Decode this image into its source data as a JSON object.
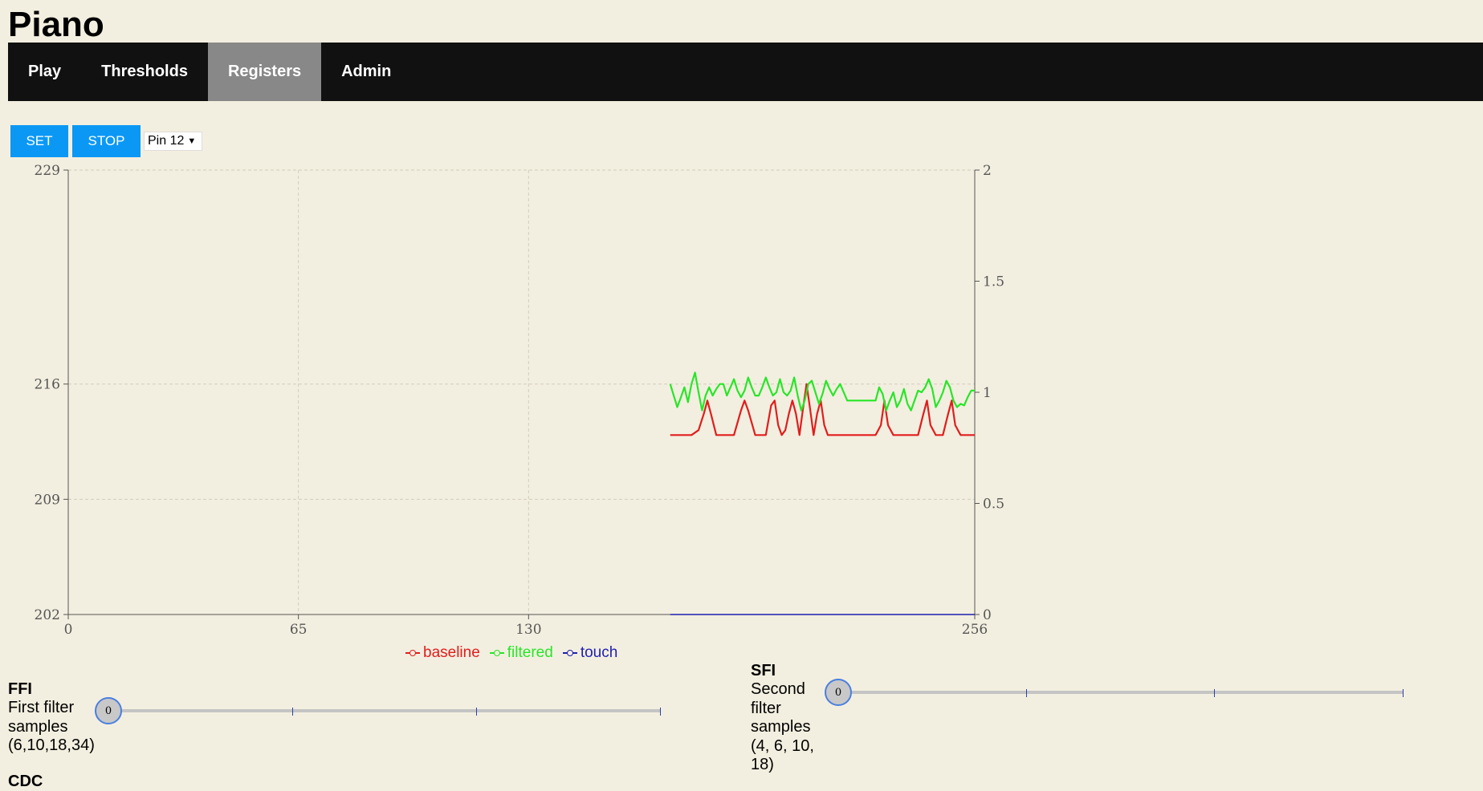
{
  "app": {
    "title": "Piano"
  },
  "nav": {
    "items": [
      {
        "label": "Play"
      },
      {
        "label": "Thresholds"
      },
      {
        "label": "Registers"
      },
      {
        "label": "Admin"
      }
    ]
  },
  "toolbar": {
    "set_label": "SET",
    "stop_label": "STOP",
    "pin_selected": "Pin 12"
  },
  "chart_data": {
    "type": "line",
    "x_ticks": [
      0,
      65,
      130,
      256
    ],
    "xlim": [
      0,
      256
    ],
    "y_left_ticks": [
      202,
      209,
      216,
      229
    ],
    "ylim_left": [
      202,
      229
    ],
    "y_right_ticks": [
      0,
      0.5,
      1,
      1.5,
      2
    ],
    "ylim_right": [
      0,
      2
    ],
    "grid": true,
    "legend_position": "bottom-center",
    "series": [
      {
        "name": "baseline",
        "axis": "left",
        "color": "#e11d1d",
        "points": [
          [
            170,
            212.9
          ],
          [
            176,
            212.9
          ],
          [
            178,
            213.2
          ],
          [
            179.5,
            214.2
          ],
          [
            180.5,
            215
          ],
          [
            181.5,
            214.2
          ],
          [
            183,
            212.9
          ],
          [
            188,
            212.9
          ],
          [
            190,
            214.4
          ],
          [
            191,
            215
          ],
          [
            192,
            214.4
          ],
          [
            194,
            212.9
          ],
          [
            197,
            212.9
          ],
          [
            198.5,
            214.7
          ],
          [
            199.5,
            215
          ],
          [
            200.5,
            213.5
          ],
          [
            201.5,
            212.9
          ],
          [
            202.5,
            213.2
          ],
          [
            203.5,
            214.2
          ],
          [
            204.5,
            215
          ],
          [
            205.5,
            214.2
          ],
          [
            206.5,
            212.9
          ],
          [
            207.5,
            214.5
          ],
          [
            208.5,
            216
          ],
          [
            209.5,
            214.5
          ],
          [
            210.5,
            212.9
          ],
          [
            211.5,
            214.2
          ],
          [
            212.5,
            215
          ],
          [
            213.5,
            213.5
          ],
          [
            214.5,
            212.9
          ],
          [
            228,
            212.9
          ],
          [
            229.5,
            213.5
          ],
          [
            230.5,
            215
          ],
          [
            231.5,
            213.5
          ],
          [
            233,
            212.9
          ],
          [
            240,
            212.9
          ],
          [
            241.5,
            214.2
          ],
          [
            242.5,
            215
          ],
          [
            243.5,
            213.5
          ],
          [
            245,
            212.9
          ],
          [
            247,
            212.9
          ],
          [
            248.5,
            214.2
          ],
          [
            249.5,
            215
          ],
          [
            250.5,
            213.5
          ],
          [
            252,
            212.9
          ],
          [
            256,
            212.9
          ]
        ]
      },
      {
        "name": "filtered",
        "axis": "left",
        "color": "#27e627",
        "points": [
          [
            170,
            216
          ],
          [
            172,
            214.6
          ],
          [
            173,
            215.2
          ],
          [
            174,
            215.8
          ],
          [
            175,
            214.9
          ],
          [
            176,
            216
          ],
          [
            177,
            216.7
          ],
          [
            178,
            215.5
          ],
          [
            179,
            214.4
          ],
          [
            180,
            215.3
          ],
          [
            181,
            215.8
          ],
          [
            182,
            215.3
          ],
          [
            183,
            215.7
          ],
          [
            184,
            216
          ],
          [
            185,
            216
          ],
          [
            186,
            215.3
          ],
          [
            187,
            215.8
          ],
          [
            188,
            216.3
          ],
          [
            189,
            215.6
          ],
          [
            190,
            215.2
          ],
          [
            191,
            215.6
          ],
          [
            192,
            216.4
          ],
          [
            193,
            215.8
          ],
          [
            194,
            215.3
          ],
          [
            195,
            215.3
          ],
          [
            196,
            215.8
          ],
          [
            197,
            216.4
          ],
          [
            198,
            215.8
          ],
          [
            199,
            215.3
          ],
          [
            200,
            215.5
          ],
          [
            201,
            216.3
          ],
          [
            202,
            215.5
          ],
          [
            203,
            215.3
          ],
          [
            204,
            215.6
          ],
          [
            205,
            216.4
          ],
          [
            206,
            215.3
          ],
          [
            207,
            214.4
          ],
          [
            208,
            215
          ],
          [
            209,
            216
          ],
          [
            210,
            216.2
          ],
          [
            211,
            215.5
          ],
          [
            212,
            214.8
          ],
          [
            213,
            215.4
          ],
          [
            214,
            216.2
          ],
          [
            215,
            215.7
          ],
          [
            216,
            215.3
          ],
          [
            217,
            215.7
          ],
          [
            218,
            216
          ],
          [
            219,
            215.5
          ],
          [
            220,
            215
          ],
          [
            228,
            215
          ],
          [
            229,
            215.8
          ],
          [
            230,
            215.4
          ],
          [
            231,
            214.4
          ],
          [
            232,
            215
          ],
          [
            233,
            215.5
          ],
          [
            234,
            214.6
          ],
          [
            235,
            215
          ],
          [
            236,
            215.7
          ],
          [
            237,
            214.8
          ],
          [
            238,
            214.4
          ],
          [
            239,
            215
          ],
          [
            240,
            215.6
          ],
          [
            241,
            215.5
          ],
          [
            242,
            215.8
          ],
          [
            243,
            216.3
          ],
          [
            244,
            215.7
          ],
          [
            245,
            214.6
          ],
          [
            246,
            215
          ],
          [
            247,
            215.5
          ],
          [
            248,
            216.2
          ],
          [
            249,
            215.8
          ],
          [
            250,
            215
          ],
          [
            251,
            214.6
          ],
          [
            252,
            214.8
          ],
          [
            253,
            214.7
          ],
          [
            254,
            215.2
          ],
          [
            255,
            215.6
          ],
          [
            256,
            215.6
          ]
        ]
      },
      {
        "name": "touch",
        "axis": "right",
        "color": "#1f1fb0",
        "points": [
          [
            170,
            0
          ],
          [
            256,
            0
          ]
        ]
      }
    ]
  },
  "params": {
    "ffi": {
      "name": "FFI",
      "desc_lines": [
        "First filter",
        "samples",
        "(6,10,18,34)"
      ],
      "value": "0"
    },
    "sfi": {
      "name": "SFI",
      "desc_lines": [
        "Second",
        "filter",
        "samples",
        "(4, 6, 10,",
        "18)"
      ],
      "value": "0"
    },
    "cdc": {
      "name": "CDC"
    }
  }
}
